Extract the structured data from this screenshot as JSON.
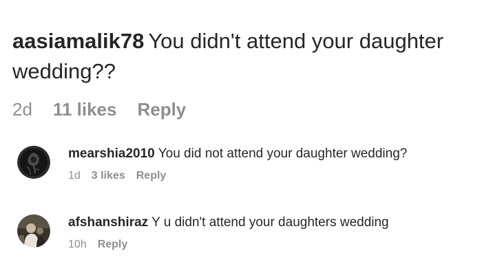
{
  "main_comment": {
    "username": "aasiamalik78",
    "text": "You didn't attend your daughter wedding??",
    "time": "2d",
    "likes": "11 likes",
    "reply_label": "Reply"
  },
  "replies": [
    {
      "username": "mearshia2010",
      "text": "You did not attend your daughter wedding?",
      "time": "1d",
      "likes": "3 likes",
      "reply_label": "Reply",
      "avatar_icon": "dark-rose-avatar"
    },
    {
      "username": "afshanshiraz",
      "text": "Y u didn't attend your daughters wedding",
      "time": "10h",
      "reply_label": "Reply",
      "avatar_icon": "portrait-avatar"
    }
  ],
  "colors": {
    "text_primary": "#262626",
    "text_secondary": "#8e8e8e",
    "background": "#ffffff"
  }
}
